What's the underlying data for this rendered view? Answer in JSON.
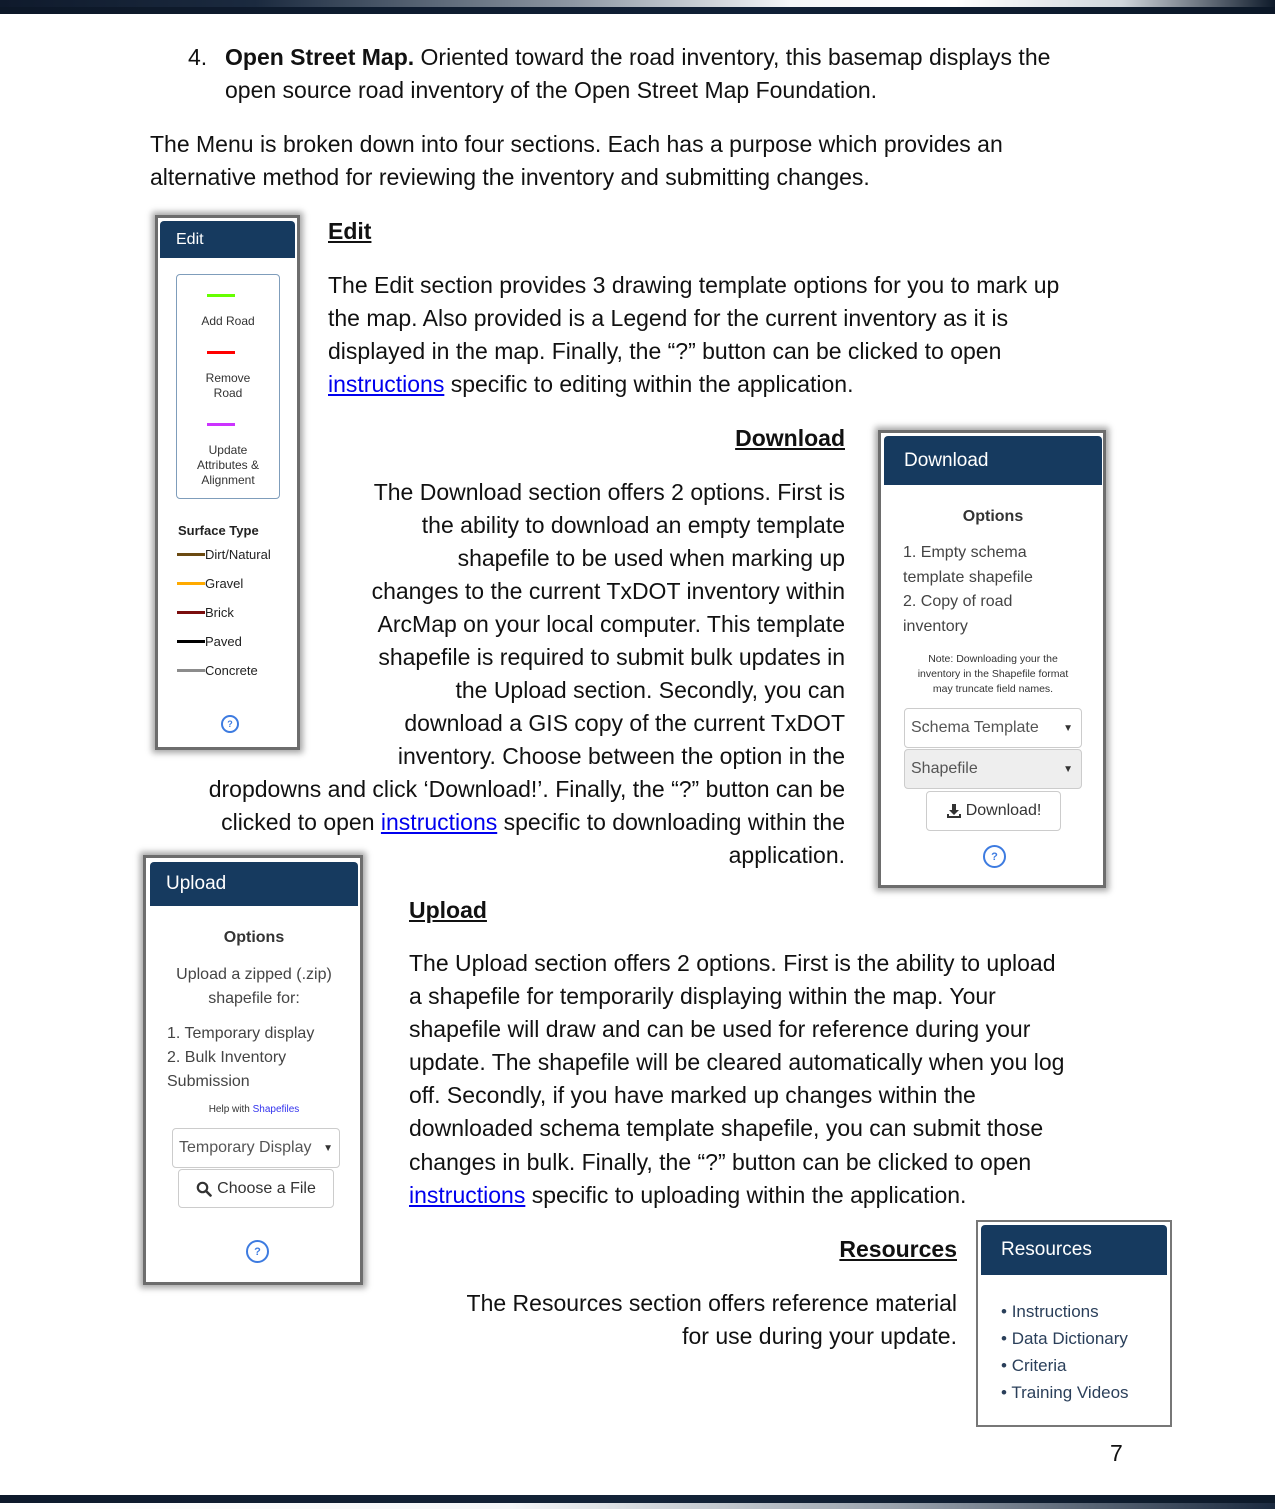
{
  "intro": {
    "list_number": "4.",
    "item_title": "Open Street Map.",
    "item_text_line1": " Oriented toward the road inventory, this basemap displays the",
    "item_text_line2": "open source road inventory of the Open Street Map Foundation.",
    "menu_line1": "The Menu is broken down into four sections. Each has a purpose which provides an",
    "menu_line2": "alternative method for reviewing the inventory and submitting changes."
  },
  "edit_section": {
    "heading": "Edit",
    "lines": [
      "The Edit section provides 3 drawing template options for you to mark up",
      "the map. Also provided is a Legend for the current inventory as it is",
      "displayed in the map. Finally, the “?” button can be clicked to open"
    ],
    "link_text": "instructions",
    "last_line_rest": " specific to editing within the application."
  },
  "download_section": {
    "heading": "Download",
    "lines": [
      "The Download section offers 2 options. First is",
      "the ability to download an empty template",
      "shapefile to be used when marking up",
      "changes to the current TxDOT inventory within",
      "ArcMap on your local computer. This template",
      "shapefile is required to submit bulk updates in",
      "the Upload section. Secondly, you can",
      "download a GIS copy of the current TxDOT",
      "inventory. Choose between the option in the",
      "dropdowns and click ‘Download!’. Finally, the “?” button can be"
    ],
    "link_prefix": "clicked to open ",
    "link_text": "instructions",
    "link_suffix": " specific to downloading within the",
    "last_line": "application."
  },
  "upload_section": {
    "heading": "Upload",
    "lines": [
      "The Upload section offers 2 options. First is the ability to upload",
      "a shapefile for temporarily displaying within the map. Your",
      "shapefile will draw and can be used for reference during your",
      "update. The shapefile will be cleared automatically when you log",
      "off. Secondly, if you have marked up changes within the",
      "downloaded schema template shapefile, you can submit those",
      "changes in bulk. Finally, the “?” button can be clicked to open"
    ],
    "link_text": "instructions",
    "last_line_rest": " specific to uploading within the application."
  },
  "resources_section": {
    "heading": "Resources",
    "lines": [
      "The Resources section offers reference material",
      "for use during your update."
    ]
  },
  "edit_panel": {
    "title": "Edit",
    "tools": [
      {
        "label": "Add Road",
        "color": "#66ff00"
      },
      {
        "label": "Remove Road",
        "color": "#ff0000"
      },
      {
        "label": "Update Attributes & Alignment",
        "color": "#cc33ff"
      }
    ],
    "legend_title": "Surface Type",
    "legend": [
      {
        "label": "Dirt/Natural",
        "color": "#6b4a12"
      },
      {
        "label": "Gravel",
        "color": "#ffaa00"
      },
      {
        "label": "Brick",
        "color": "#7a0d0d"
      },
      {
        "label": "Paved",
        "color": "#000000"
      },
      {
        "label": "Concrete",
        "color": "#8c8c8c"
      }
    ],
    "help": "?"
  },
  "download_panel": {
    "title": "Download",
    "options_title": "Options",
    "options": [
      "1. Empty schema",
      "template shapefile",
      "2. Copy of road",
      "inventory"
    ],
    "note": [
      "Note: Downloading your the",
      "inventory in the Shapefile format",
      "may truncate field names."
    ],
    "select_type": "Schema Template",
    "select_format": "Shapefile",
    "download_button": "Download!",
    "help": "?"
  },
  "upload_panel": {
    "title": "Upload",
    "options_title": "Options",
    "intro": [
      "Upload a zipped (.zip)",
      "shapefile for:"
    ],
    "options": [
      "1. Temporary display",
      "2. Bulk Inventory",
      "Submission"
    ],
    "help_prefix": "Help with ",
    "help_link": "Shapefiles",
    "select_mode": "Temporary Display",
    "choose_button": "Choose a File",
    "help": "?"
  },
  "resources_panel": {
    "title": "Resources",
    "items": [
      "Instructions",
      "Data Dictionary",
      "Criteria",
      "Training Videos"
    ]
  },
  "colors": {
    "panel_header": "#163a5f",
    "link": "#0000ee"
  },
  "page_number": "7"
}
